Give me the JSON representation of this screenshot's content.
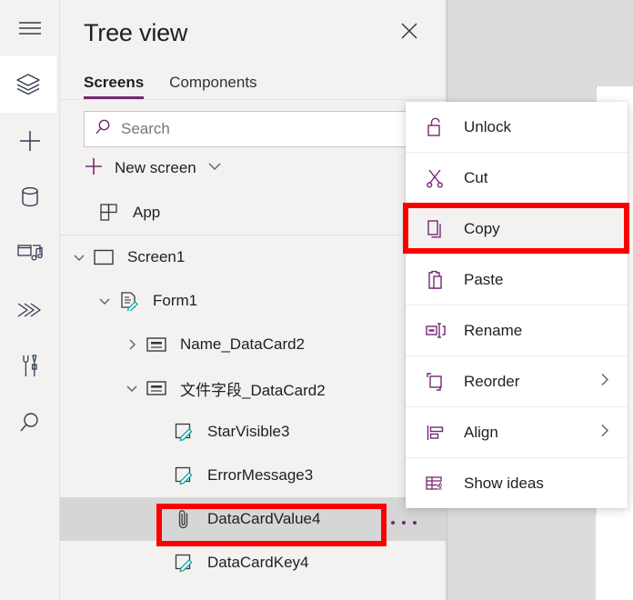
{
  "colors": {
    "accent": "#742774",
    "annotation": "#fb0000",
    "panel_bg": "#f3f2f1",
    "selected_row": "#d6d6d6",
    "text": "#201f1e"
  },
  "rail": {
    "items": [
      {
        "name": "hamburger-menu",
        "icon": "hamburger-icon",
        "selected": false
      },
      {
        "name": "tree-view",
        "icon": "layers-icon",
        "selected": true
      },
      {
        "name": "insert",
        "icon": "plus-icon",
        "selected": false
      },
      {
        "name": "data",
        "icon": "database-icon",
        "selected": false
      },
      {
        "name": "media",
        "icon": "media-icon",
        "selected": false
      },
      {
        "name": "power-automate",
        "icon": "flow-icon",
        "selected": false
      },
      {
        "name": "variables",
        "icon": "tools-icon",
        "selected": false
      },
      {
        "name": "search",
        "icon": "search-icon",
        "selected": false
      }
    ]
  },
  "panel": {
    "title": "Tree view",
    "close_label": "Close",
    "tabs": [
      {
        "label": "Screens",
        "active": true
      },
      {
        "label": "Components",
        "active": false
      }
    ],
    "search": {
      "placeholder": "Search",
      "value": ""
    },
    "new_screen": {
      "label": "New screen"
    }
  },
  "tree": {
    "items": [
      {
        "label": "App",
        "indent": 0,
        "chevron": "none",
        "icon": "app-icon",
        "selected": false
      },
      {
        "label": "Screen1",
        "indent": 0,
        "chevron": "expanded",
        "icon": "screen-icon",
        "selected": false
      },
      {
        "label": "Form1",
        "indent": 1,
        "chevron": "expanded",
        "icon": "form-icon",
        "selected": false
      },
      {
        "label": "Name_DataCard2",
        "indent": 2,
        "chevron": "collapsed",
        "icon": "datacard-icon",
        "selected": false
      },
      {
        "label": "文件字段_DataCard2",
        "indent": 2,
        "chevron": "expanded",
        "icon": "datacard-icon",
        "selected": false
      },
      {
        "label": "StarVisible3",
        "indent": 3,
        "chevron": "none",
        "icon": "label-icon",
        "selected": false
      },
      {
        "label": "ErrorMessage3",
        "indent": 3,
        "chevron": "none",
        "icon": "label-icon",
        "selected": false
      },
      {
        "label": "DataCardValue4",
        "indent": 3,
        "chevron": "none",
        "icon": "attachment-icon",
        "selected": true
      },
      {
        "label": "DataCardKey4",
        "indent": 3,
        "chevron": "none",
        "icon": "label-icon",
        "selected": false
      }
    ],
    "overflow_label": "More options"
  },
  "context_menu": {
    "items": [
      {
        "label": "Unlock",
        "icon": "unlock-icon",
        "submenu": false,
        "highlighted": false,
        "divider_after": false
      },
      {
        "label": "Cut",
        "icon": "scissors-icon",
        "submenu": false,
        "highlighted": false,
        "divider_after": false
      },
      {
        "label": "Copy",
        "icon": "copy-icon",
        "submenu": false,
        "highlighted": true,
        "divider_after": false
      },
      {
        "label": "Paste",
        "icon": "paste-icon",
        "submenu": false,
        "highlighted": false,
        "divider_after": true
      },
      {
        "label": "Rename",
        "icon": "rename-icon",
        "submenu": false,
        "highlighted": false,
        "divider_after": false
      },
      {
        "label": "Reorder",
        "icon": "reorder-icon",
        "submenu": true,
        "highlighted": false,
        "divider_after": false
      },
      {
        "label": "Align",
        "icon": "align-icon",
        "submenu": true,
        "highlighted": false,
        "divider_after": true
      },
      {
        "label": "Show ideas",
        "icon": "ideas-icon",
        "submenu": false,
        "highlighted": false,
        "divider_after": false
      }
    ]
  },
  "annotations": [
    {
      "name": "copy-menu-item-highlight",
      "target": "Copy"
    },
    {
      "name": "datacardvalue4-node-highlight",
      "target": "DataCardValue4"
    }
  ]
}
